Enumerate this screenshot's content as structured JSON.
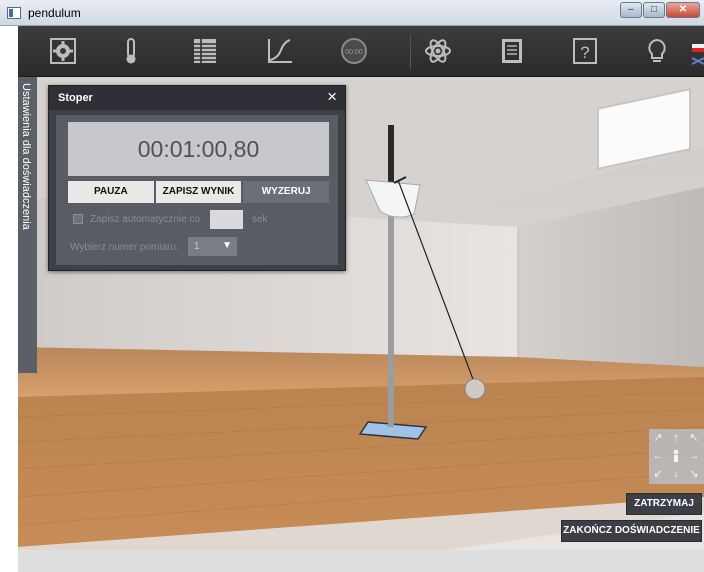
{
  "window": {
    "title": "pendulum",
    "controls": {
      "minimize": "–",
      "maximize": "□",
      "close": "✕"
    }
  },
  "toolbar": {
    "icons": [
      "gear-icon",
      "thermometer-icon",
      "table-icon",
      "graph-icon",
      "stopwatch-icon",
      "atom-icon",
      "notebook-icon",
      "help-icon",
      "lightbulb-icon",
      "flag-icon"
    ],
    "stopwatch_icon_text": "00:00",
    "help_label": "?"
  },
  "sidebar": {
    "tab_label": "Ustawienia dla doświadczenia"
  },
  "stopwatch": {
    "title": "Stoper",
    "close_label": "×",
    "time": "00:01:00,80",
    "buttons": {
      "pause": "PAUZA",
      "save_result": "ZAPISZ WYNIK",
      "reset": "WYZERUJ"
    },
    "auto_save_label": "Zapisz automatycznie co",
    "auto_save_value": "",
    "auto_save_unit": "sek",
    "measurement_label": "Wybierz numer pomiaru:",
    "measurement_value": "1"
  },
  "navigation": {
    "pad_arrows": [
      "↗",
      "↑",
      "↖",
      "←",
      "person",
      "→",
      "↙",
      "↓",
      "↘"
    ]
  },
  "experiment": {
    "stop_label": "ZATRZYMAJ",
    "end_label": "ZAKOŃCZ DOŚWIADCZENIE"
  },
  "colors": {
    "toolbar_bg": "#2f2f2f",
    "panel_bg": "#3d4046",
    "accent_button": "#6b6e75"
  }
}
